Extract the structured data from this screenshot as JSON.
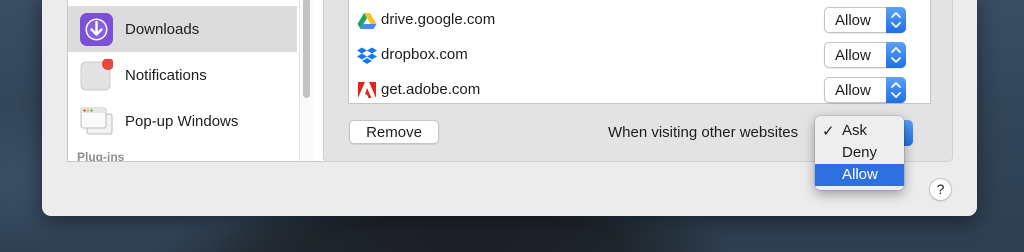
{
  "sidebar": {
    "items": [
      {
        "label": "Downloads",
        "icon": "downloads-icon",
        "selected": true
      },
      {
        "label": "Notifications",
        "icon": "notifications-icon",
        "selected": false
      },
      {
        "label": "Pop-up Windows",
        "icon": "popup-windows-icon",
        "selected": false
      }
    ],
    "section_header": "Plug-ins"
  },
  "sites": [
    {
      "name": "drive.google.com",
      "icon": "google-drive-icon",
      "setting": "Allow"
    },
    {
      "name": "dropbox.com",
      "icon": "dropbox-icon",
      "setting": "Allow"
    },
    {
      "name": "get.adobe.com",
      "icon": "adobe-icon",
      "setting": "Allow"
    }
  ],
  "footer": {
    "remove_label": "Remove",
    "other_websites_label": "When visiting other websites"
  },
  "menu": {
    "checkmark": "✓",
    "options": [
      {
        "label": "Ask",
        "checked": true,
        "highlighted": false
      },
      {
        "label": "Deny",
        "checked": false,
        "highlighted": false
      },
      {
        "label": "Allow",
        "checked": false,
        "highlighted": true
      }
    ]
  },
  "help_label": "?",
  "colors": {
    "accent": "#2f70e0",
    "selection": "#dcdcdc",
    "badge": "#e8473c"
  }
}
